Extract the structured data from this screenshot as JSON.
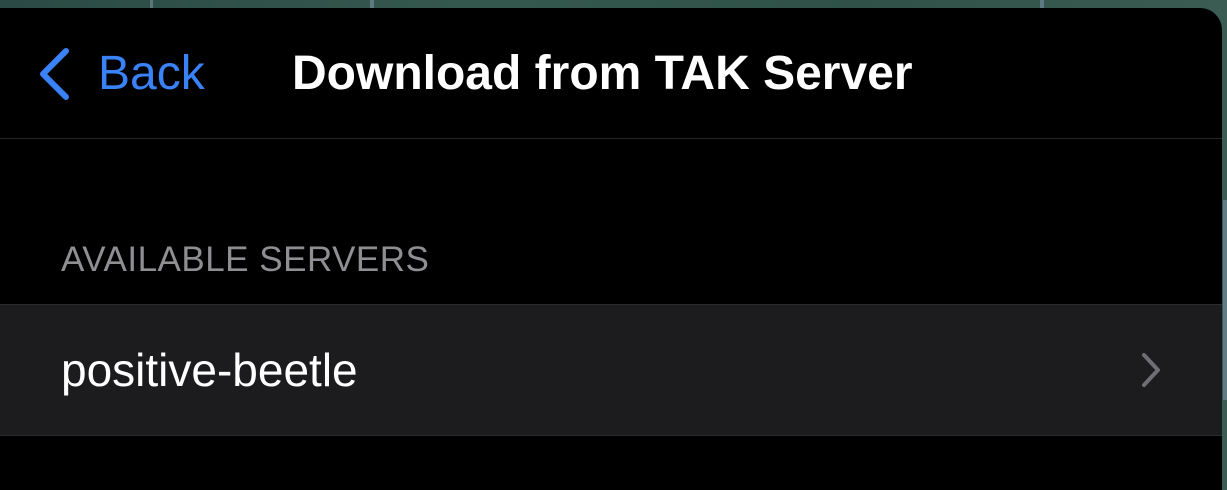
{
  "nav": {
    "back_label": "Back",
    "title": "Download from TAK Server"
  },
  "section": {
    "header": "AVAILABLE SERVERS"
  },
  "servers": [
    {
      "name": "positive-beetle"
    }
  ],
  "colors": {
    "accent": "#3a82f7",
    "background": "#000000",
    "row_background": "#1c1c1e",
    "header_text": "#8e8e93"
  },
  "icons": {
    "back": "chevron-left-icon",
    "row": "chevron-right-icon"
  }
}
